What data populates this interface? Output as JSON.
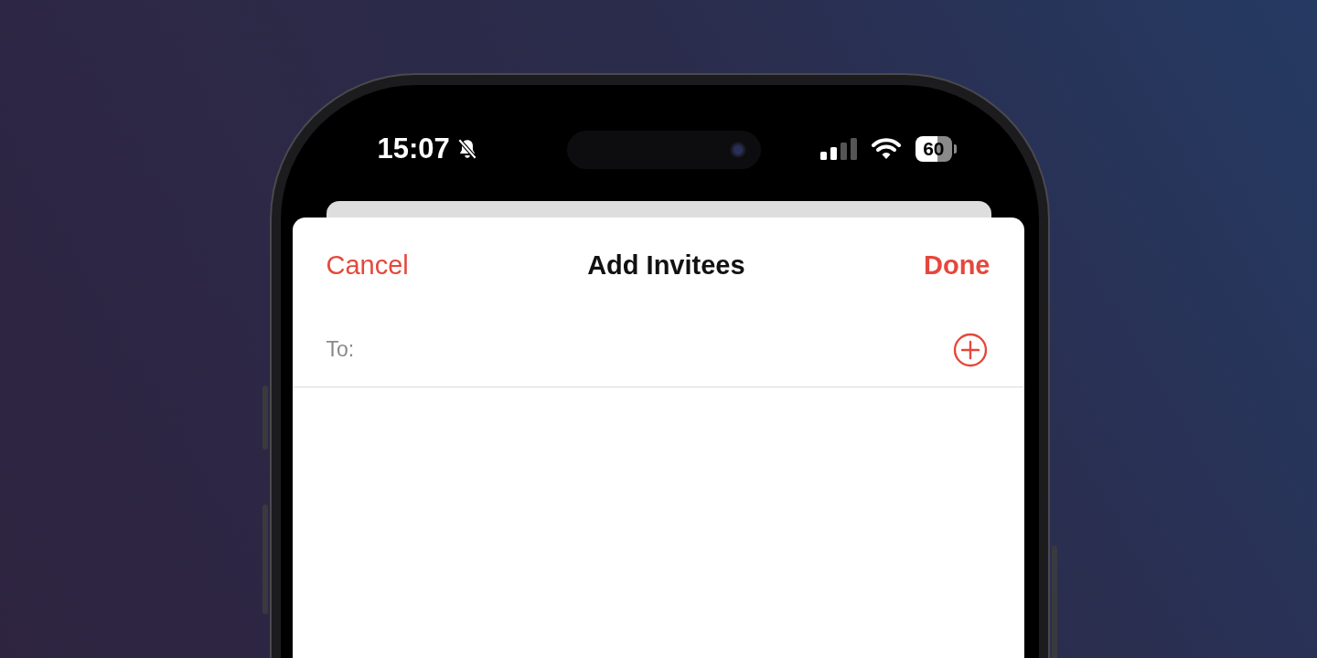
{
  "status_bar": {
    "time": "15:07",
    "muted": true,
    "battery": "60"
  },
  "sheet": {
    "cancel": "Cancel",
    "title": "Add Invitees",
    "done": "Done",
    "to_label": "To:"
  }
}
